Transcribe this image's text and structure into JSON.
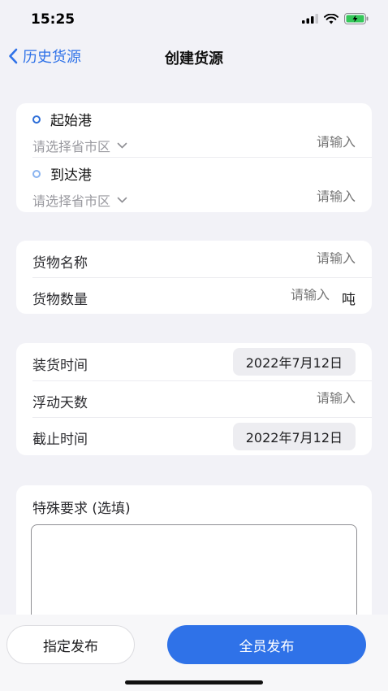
{
  "status_bar": {
    "time": "15:25"
  },
  "nav": {
    "back_label": "历史货源",
    "title": "创建货源"
  },
  "route": {
    "origin": {
      "label": "起始港",
      "region_placeholder": "请选择省市区",
      "input_placeholder": "请输入"
    },
    "destination": {
      "label": "到达港",
      "region_placeholder": "请选择省市区",
      "input_placeholder": "请输入"
    }
  },
  "cargo": {
    "name_label": "货物名称",
    "name_placeholder": "请输入",
    "qty_label": "货物数量",
    "qty_placeholder": "请输入",
    "qty_unit": "吨"
  },
  "schedule": {
    "loading_label": "装货时间",
    "loading_date": "2022年7月12日",
    "float_label": "浮动天数",
    "float_placeholder": "请输入",
    "deadline_label": "截止时间",
    "deadline_date": "2022年7月12日"
  },
  "special": {
    "label": "特殊要求 (选填)"
  },
  "actions": {
    "designated_label": "指定发布",
    "all_label": "全员发布"
  },
  "colors": {
    "accent": "#2f72e8",
    "background": "#f2f2f7",
    "battery": "#34c759"
  }
}
